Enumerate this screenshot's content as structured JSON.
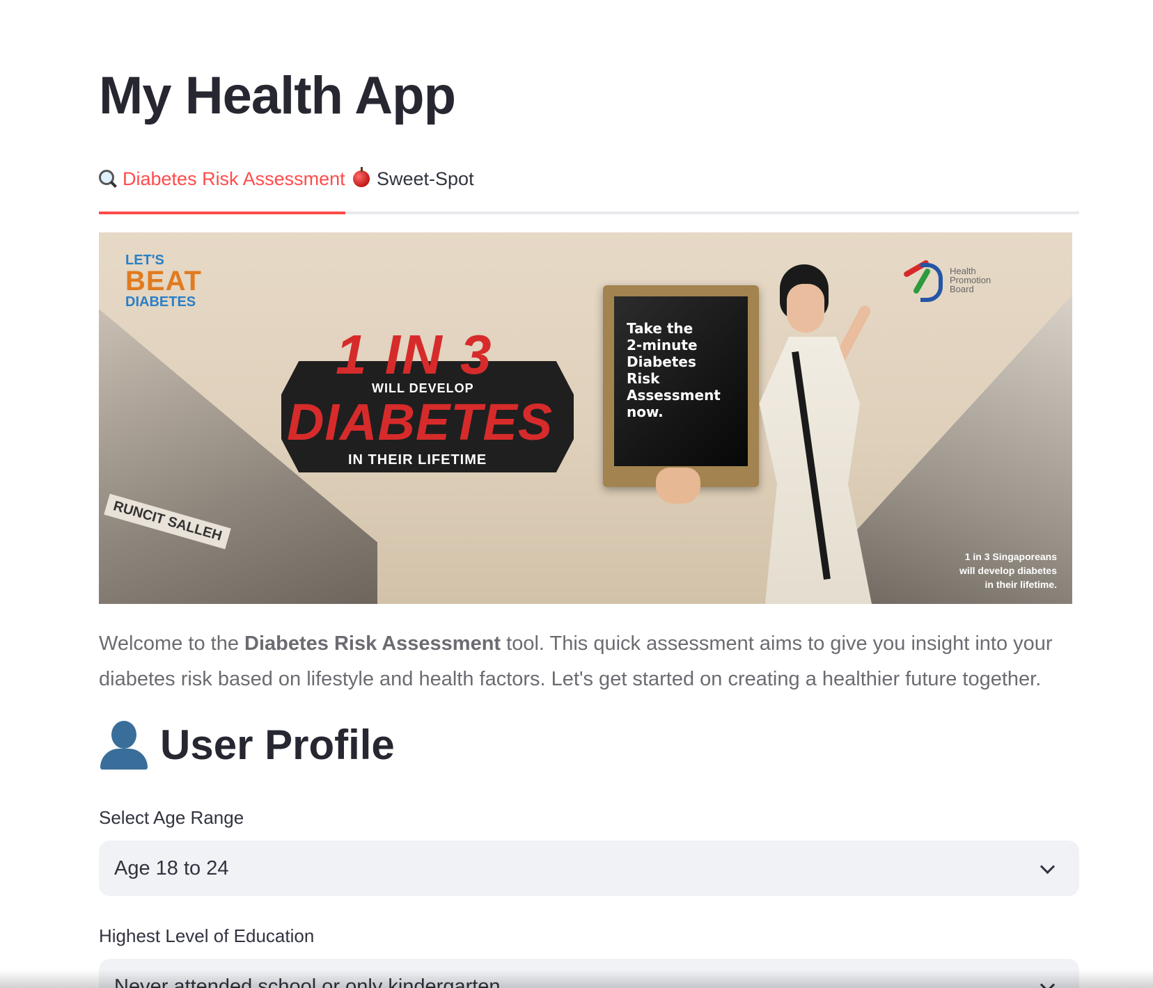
{
  "app": {
    "title": "My Health App"
  },
  "tabs": [
    {
      "icon": "magnifying-glass-icon",
      "label": "Diabetes Risk Assessment",
      "active": true
    },
    {
      "icon": "red-apple-icon",
      "label": "Sweet-Spot",
      "active": false
    }
  ],
  "colors": {
    "accent": "#ff4b4b",
    "text": "#31333f",
    "muted_text": "#6b6b72",
    "select_bg": "#f0f2f6"
  },
  "banner": {
    "logo_lets": "LET'S",
    "logo_beat": "BEAT",
    "logo_diabetes": "DIABETES",
    "headline_ratio": "1 IN 3",
    "headline_will": "WILL DEVELOP",
    "headline_diabetes": "DIABETES",
    "headline_lifetime": "IN THEIR LIFETIME",
    "slate_text": "Take the\n2-minute\nDiabetes\nRisk\nAssessment\nnow.",
    "hpb_text": "Health\nPromotion\nBoard",
    "footnote": "1 in 3 Singaporeans\nwill develop diabetes\nin their lifetime.",
    "shop_sign": "RUNCIT SALLEH"
  },
  "intro": {
    "before": "Welcome to the ",
    "bold": "Diabetes Risk Assessment",
    "after": " tool. This quick assessment aims to give you insight into your diabetes risk based on lifestyle and health factors. Let's get started on creating a healthier future together."
  },
  "user_profile": {
    "icon": "bust-in-silhouette-icon",
    "heading": "User Profile",
    "fields": [
      {
        "label": "Select Age Range",
        "value": "Age 18 to 24"
      },
      {
        "label": "Highest Level of Education",
        "value": "Never attended school or only kindergarten"
      }
    ]
  }
}
